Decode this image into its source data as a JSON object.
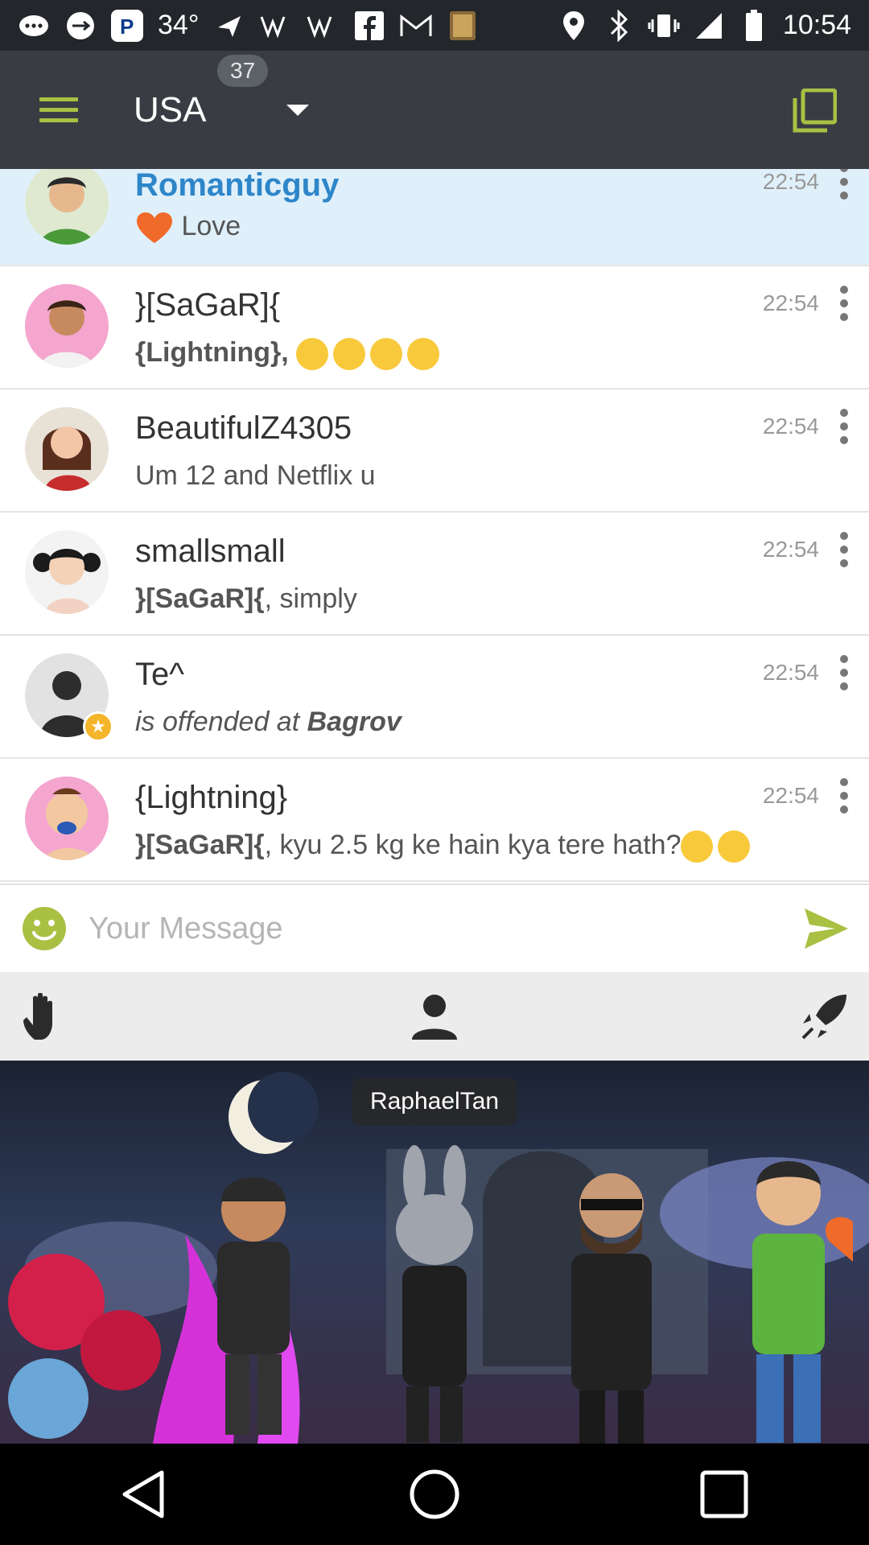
{
  "status_bar": {
    "temperature": "34°",
    "time": "10:54"
  },
  "app_bar": {
    "room_name": "USA",
    "room_count": "37"
  },
  "chats": [
    {
      "name": "Romanticguy",
      "time": "22:54",
      "message": "Love"
    },
    {
      "name": "}[SaGaR]{",
      "time": "22:54",
      "message": "{Lightning}, "
    },
    {
      "name": "BeautifulZ4305",
      "time": "22:54",
      "message": "Um 12 and Netflix u"
    },
    {
      "name": "smallsmall",
      "time": "22:54",
      "message_bold": "}[SaGaR]{",
      "message": ", simply"
    },
    {
      "name": "Te^",
      "time": "22:54",
      "message_italic": "is offended at ",
      "message_bold": "Bagrov"
    },
    {
      "name": "{Lightning}",
      "time": "22:54",
      "message_bold": "}[SaGaR]{",
      "message": ", kyu 2.5 kg ke hain kya tere hath?"
    }
  ],
  "composer": {
    "placeholder": "Your Message"
  },
  "scene": {
    "label": "RaphaelTan"
  },
  "colors": {
    "accent": "#a9c043",
    "highlight_row": "#e0f0fa",
    "name_highlight": "#2e86c9"
  }
}
